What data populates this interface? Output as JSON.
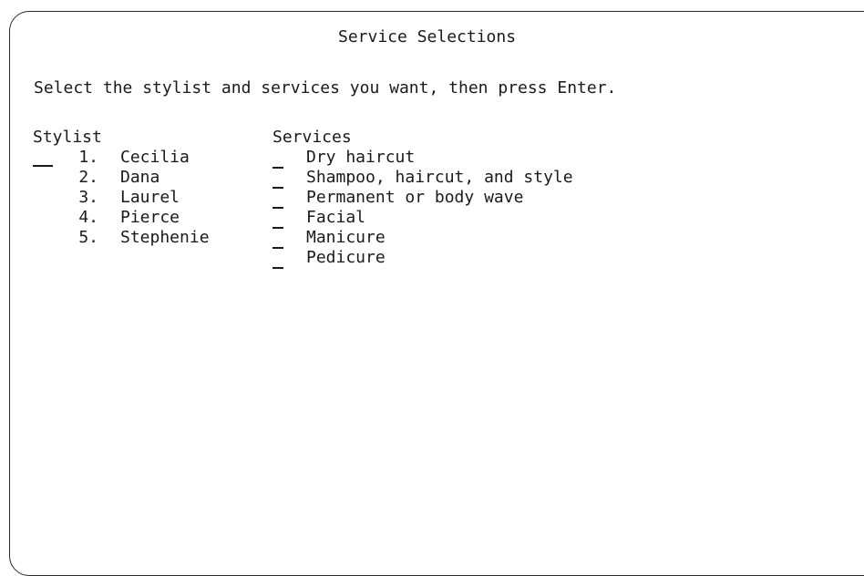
{
  "screen": {
    "title": "Service Selections",
    "instructions": "Select the stylist and services you want, then press Enter."
  },
  "stylist": {
    "header": "Stylist",
    "input_value": "",
    "options": [
      {
        "number": "1.",
        "name": "Cecilia"
      },
      {
        "number": "2.",
        "name": "Dana"
      },
      {
        "number": "3.",
        "name": "Laurel"
      },
      {
        "number": "4.",
        "name": "Pierce"
      },
      {
        "number": "5.",
        "name": "Stephenie"
      }
    ]
  },
  "services": {
    "header": "Services",
    "items": [
      {
        "label": "Dry haircut",
        "selected": ""
      },
      {
        "label": "Shampoo, haircut, and style",
        "selected": ""
      },
      {
        "label": "Permanent or body wave",
        "selected": ""
      },
      {
        "label": "Facial",
        "selected": ""
      },
      {
        "label": "Manicure",
        "selected": ""
      },
      {
        "label": "Pedicure",
        "selected": ""
      }
    ]
  }
}
